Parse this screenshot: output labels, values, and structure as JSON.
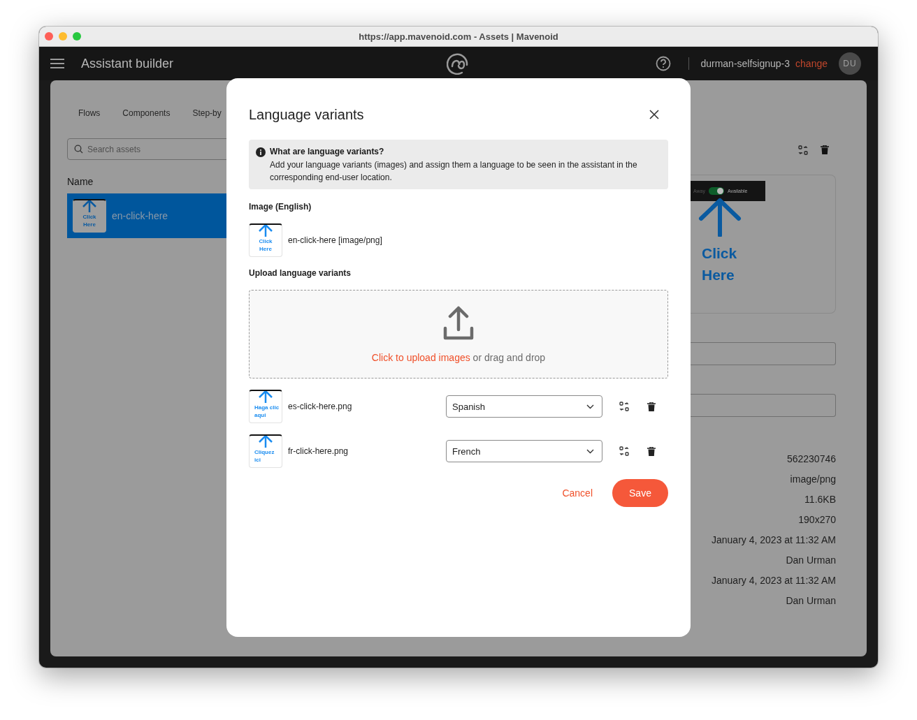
{
  "window": {
    "title": "https://app.mavenoid.com - Assets | Mavenoid"
  },
  "header": {
    "title": "Assistant builder",
    "workspace": "durman-selfsignup-3",
    "change_link": "change",
    "avatar": "DU"
  },
  "tabs": [
    {
      "label": "Flows",
      "selected": false
    },
    {
      "label": "Components",
      "selected": false
    },
    {
      "label": "Step-by",
      "selected": false
    }
  ],
  "search": {
    "placeholder": "Search assets"
  },
  "asset_list": {
    "heading": "Name",
    "items": [
      {
        "name": "en-click-here",
        "thumbnail_text": "Click Here",
        "selected": true
      }
    ]
  },
  "preview": {
    "toggle_off_label": "Away",
    "toggle_on_label": "Available",
    "toggle_on": true,
    "image_text": "Click Here"
  },
  "details": {
    "values": [
      "562230746",
      "image/png",
      "11.6KB",
      "190x270",
      "January 4, 2023 at 11:32 AM",
      "Dan Urman",
      "January 4, 2023 at 11:32 AM",
      "Dan Urman"
    ]
  },
  "modal": {
    "title": "Language variants",
    "info": {
      "title": "What are language variants?",
      "body": "Add your language variants (images) and assign them a language to be seen in the assistant in the corresponding end-user location."
    },
    "original_label": "Image (English)",
    "original": {
      "thumbnail_text": "Click Here",
      "name": "en-click-here [image/png]"
    },
    "upload_label": "Upload language variants",
    "dropzone": {
      "link": "Click to upload images",
      "text": "or drag and drop"
    },
    "variants": [
      {
        "thumbnail_text": "Haga clic aqui",
        "file": "es-click-here.png",
        "language": "Spanish"
      },
      {
        "thumbnail_text": "Cliquez ici",
        "file": "fr-click-here.png",
        "language": "French"
      }
    ],
    "buttons": {
      "cancel": "Cancel",
      "save": "Save"
    }
  }
}
